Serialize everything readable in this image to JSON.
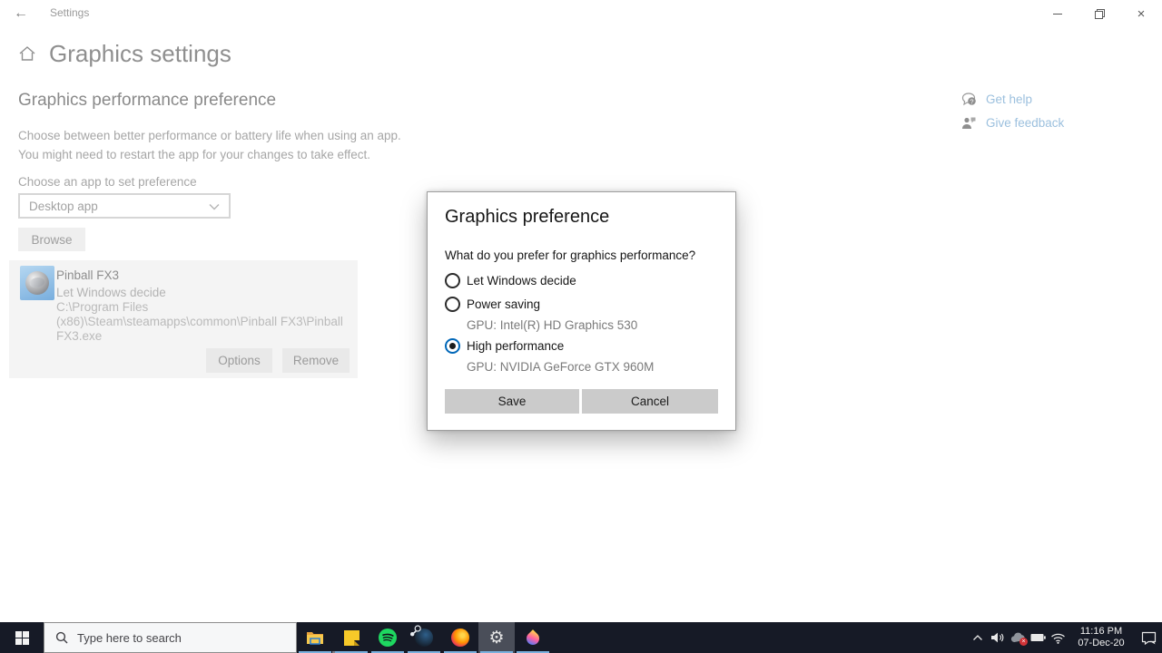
{
  "window": {
    "title": "Settings"
  },
  "page": {
    "title": "Graphics settings",
    "section_title": "Graphics performance preference",
    "description_lines": [
      "Choose between better performance or battery life when using an app.",
      "You might need to restart the app for your changes to take effect."
    ],
    "choose_app_label": "Choose an app to set preference",
    "dropdown_value": "Desktop app",
    "browse_label": "Browse",
    "app_entry": {
      "name": "Pinball FX3",
      "preference": "Let Windows decide",
      "path": "C:\\Program Files (x86)\\Steam\\steamapps\\common\\Pinball FX3\\Pinball FX3.exe",
      "options_label": "Options",
      "remove_label": "Remove"
    },
    "help_links": {
      "get_help": "Get help",
      "give_feedback": "Give feedback"
    }
  },
  "dialog": {
    "title": "Graphics preference",
    "question": "What do you prefer for graphics performance?",
    "options": [
      {
        "label": "Let Windows decide",
        "selected": false,
        "sub": ""
      },
      {
        "label": "Power saving",
        "selected": false,
        "sub": "GPU: Intel(R) HD Graphics 530"
      },
      {
        "label": "High performance",
        "selected": true,
        "sub": "GPU: NVIDIA GeForce GTX 960M"
      }
    ],
    "save_label": "Save",
    "cancel_label": "Cancel"
  },
  "taskbar": {
    "search_placeholder": "Type here to search",
    "pinned_apps": [
      "file-explorer",
      "sticky-notes",
      "spotify",
      "steam",
      "firefox",
      "settings",
      "color-drop-app"
    ],
    "tray_icons": [
      "hidden-icons-chevron",
      "volume",
      "onedrive",
      "battery",
      "wifi",
      "action-center"
    ],
    "clock": {
      "time": "11:16 PM",
      "date": "07-Dec-20"
    }
  },
  "colors": {
    "accent_radio": "#0067b8",
    "radio_dot": "#1b1b1b",
    "taskbar_bg": "#161a26",
    "taskbar_underline": "#7ab0dd",
    "dialog_button_bg": "#cbcbcb",
    "dimmed_link": "#9cc0de",
    "dimmed_text": "#a6a6a6"
  }
}
